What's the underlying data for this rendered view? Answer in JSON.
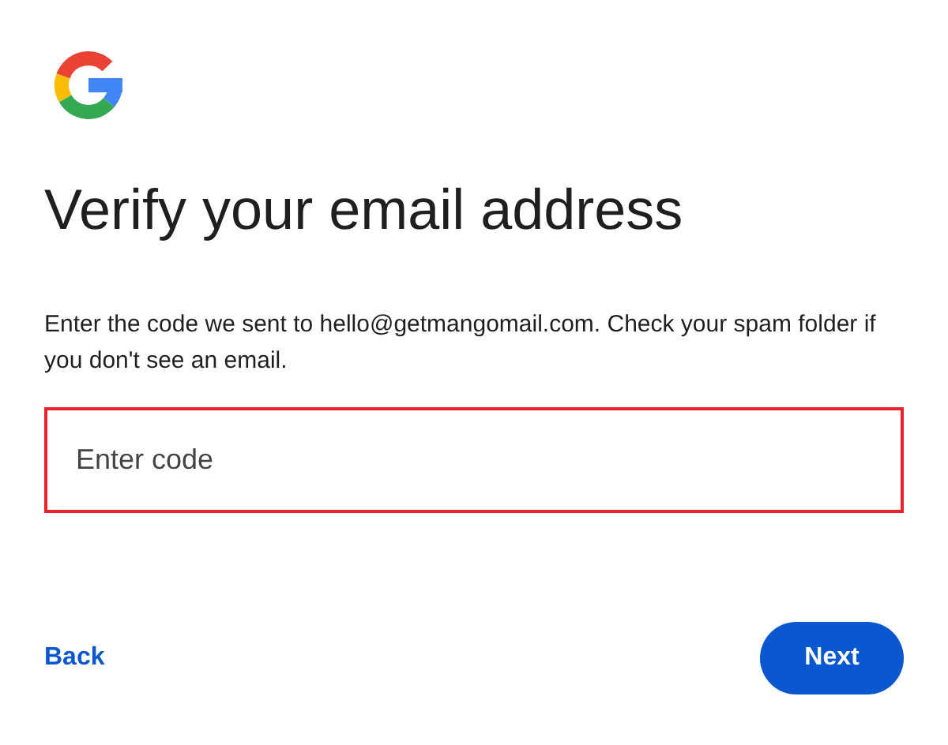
{
  "title": "Verify your email address",
  "description": "Enter the code we sent to hello@getmangomail.com. Check your spam folder if you don't see an email.",
  "code_field": {
    "placeholder": "Enter code",
    "highlighted": true
  },
  "buttons": [
    {
      "label": "Back",
      "kind": "text"
    },
    {
      "label": "Next",
      "kind": "filled"
    }
  ]
}
